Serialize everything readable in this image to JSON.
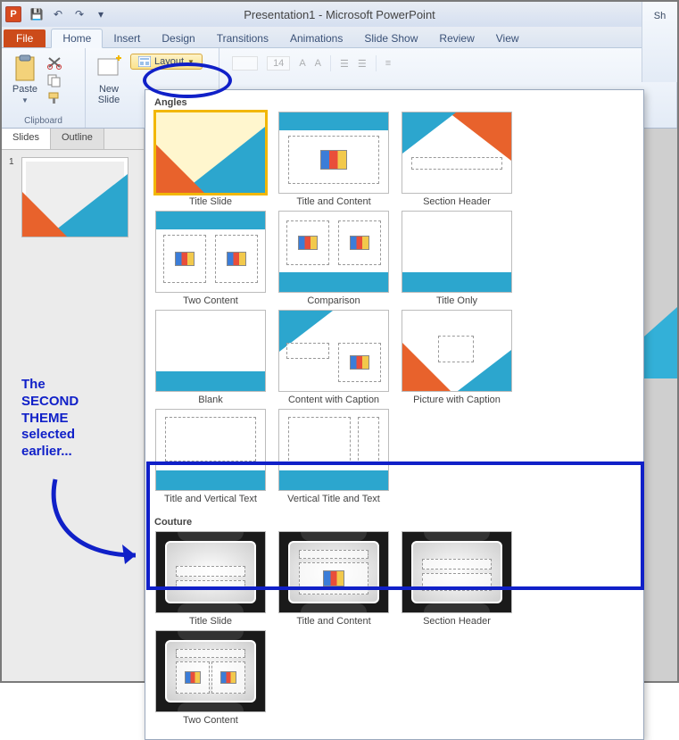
{
  "window": {
    "title": "Presentation1 - Microsoft PowerPoint"
  },
  "qat": {
    "save": "💾",
    "undo": "↶",
    "redo": "↷",
    "more": "▾"
  },
  "tabs": {
    "file": "File",
    "items": [
      "Home",
      "Insert",
      "Design",
      "Transitions",
      "Animations",
      "Slide Show",
      "Review",
      "View"
    ],
    "active": "Home"
  },
  "ribbon": {
    "clipboard": {
      "paste": "Paste",
      "label": "Clipboard"
    },
    "slides": {
      "newslide": "New\nSlide",
      "layout": "Layout"
    },
    "font_size": "14",
    "share_hint": "Sh"
  },
  "side": {
    "tabs": [
      "Slides",
      "Outline"
    ],
    "active": "Slides",
    "thumb_num": "1"
  },
  "gallery": {
    "group1": "Angles",
    "group2": "Couture",
    "angles": [
      "Title Slide",
      "Title and Content",
      "Section Header",
      "Two Content",
      "Comparison",
      "Title Only",
      "Blank",
      "Content with Caption",
      "Picture with Caption",
      "Title and Vertical Text",
      "Vertical Title and Text"
    ],
    "couture": [
      "Title Slide",
      "Title and Content",
      "Section Header",
      "Two Content"
    ]
  },
  "annotation": {
    "text": "The SECOND THEME selected earlier..."
  }
}
